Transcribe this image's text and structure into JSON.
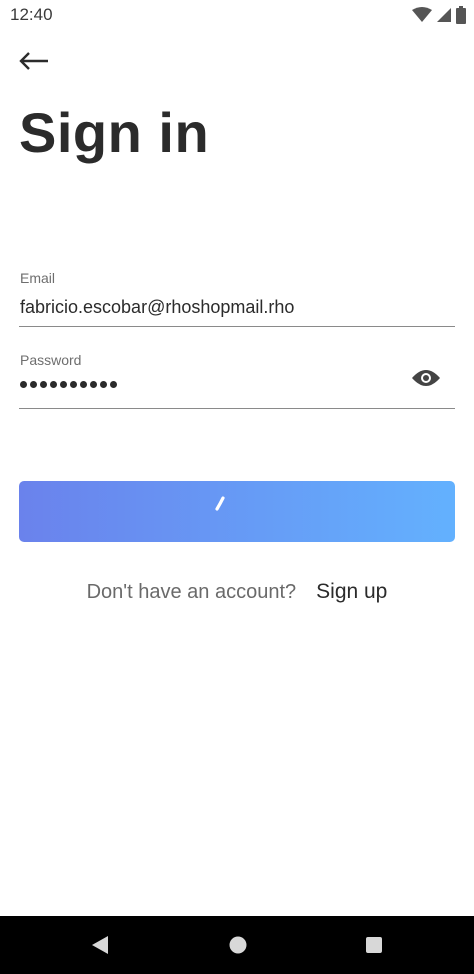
{
  "status_bar": {
    "time": "12:40",
    "icons": [
      "wifi-icon",
      "cellular-signal-icon",
      "battery-icon"
    ]
  },
  "header": {
    "back_icon": "arrow-left-icon",
    "title": "Sign in"
  },
  "form": {
    "email": {
      "label": "Email",
      "value": "fabricio.escobar@rhoshopmail.rho"
    },
    "password": {
      "label": "Password",
      "masked_length": 10,
      "toggle_icon": "eye-icon"
    },
    "submit": {
      "state": "loading",
      "icon": "loading-spinner-icon"
    }
  },
  "signup": {
    "question": "Don't have an account?",
    "link": "Sign up"
  },
  "nav_bar": {
    "icons": [
      "back-triangle-icon",
      "home-circle-icon",
      "recents-square-icon"
    ]
  },
  "colors": {
    "button_gradient_start": "#6a82ec",
    "button_gradient_end": "#63b1fe",
    "text_primary": "#2b2b2b",
    "text_secondary": "#6e6e6e",
    "nav_bar": "#000000"
  }
}
